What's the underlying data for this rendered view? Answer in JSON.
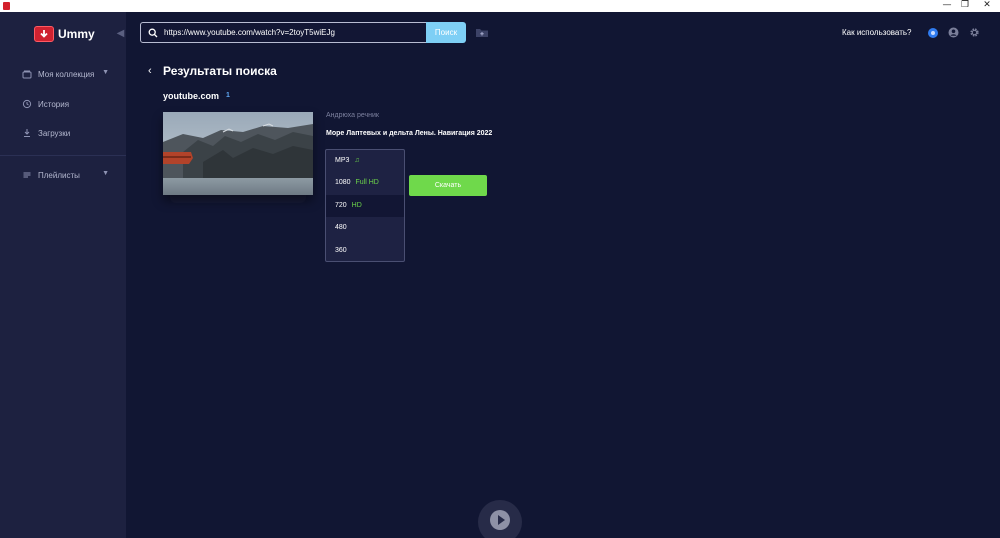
{
  "window": {
    "minimize": "—",
    "maximize": "❐",
    "close": "✕"
  },
  "app": {
    "name": "Ummy"
  },
  "sidebar": {
    "collapse_glyph": "◀",
    "items": [
      {
        "label": "Моя коллекция",
        "icon": "collection-icon",
        "chevron": "▼"
      },
      {
        "label": "История",
        "icon": "history-icon"
      },
      {
        "label": "Загрузки",
        "icon": "download-icon"
      },
      {
        "label": "Плейлисты",
        "icon": "playlist-icon",
        "chevron": "▼"
      }
    ]
  },
  "topbar": {
    "url_value": "https://www.youtube.com/watch?v=2toyT5wiEJg",
    "search_button": "Поиск",
    "help_link": "Как использовать?"
  },
  "results": {
    "back_glyph": "‹",
    "title": "Результаты поиска",
    "source": "youtube.com",
    "count": "1",
    "video": {
      "author": "Андрюха речник",
      "title": "Море Лаптевых и дельта Лены. Навигация 2022"
    },
    "formats": [
      {
        "label": "MP3",
        "quality": "♫",
        "selected": false
      },
      {
        "label": "1080",
        "quality": "Full HD",
        "selected": false
      },
      {
        "label": "720",
        "quality": "HD",
        "selected": true
      },
      {
        "label": "480",
        "quality": "",
        "selected": false
      },
      {
        "label": "360",
        "quality": "",
        "selected": false
      }
    ],
    "download_button": "Скачать"
  },
  "colors": {
    "background": "#111633",
    "sidebar": "#1d2140",
    "accent_green": "#6fd94b",
    "search_button": "#7ecff5",
    "brand_red": "#cf2230"
  }
}
